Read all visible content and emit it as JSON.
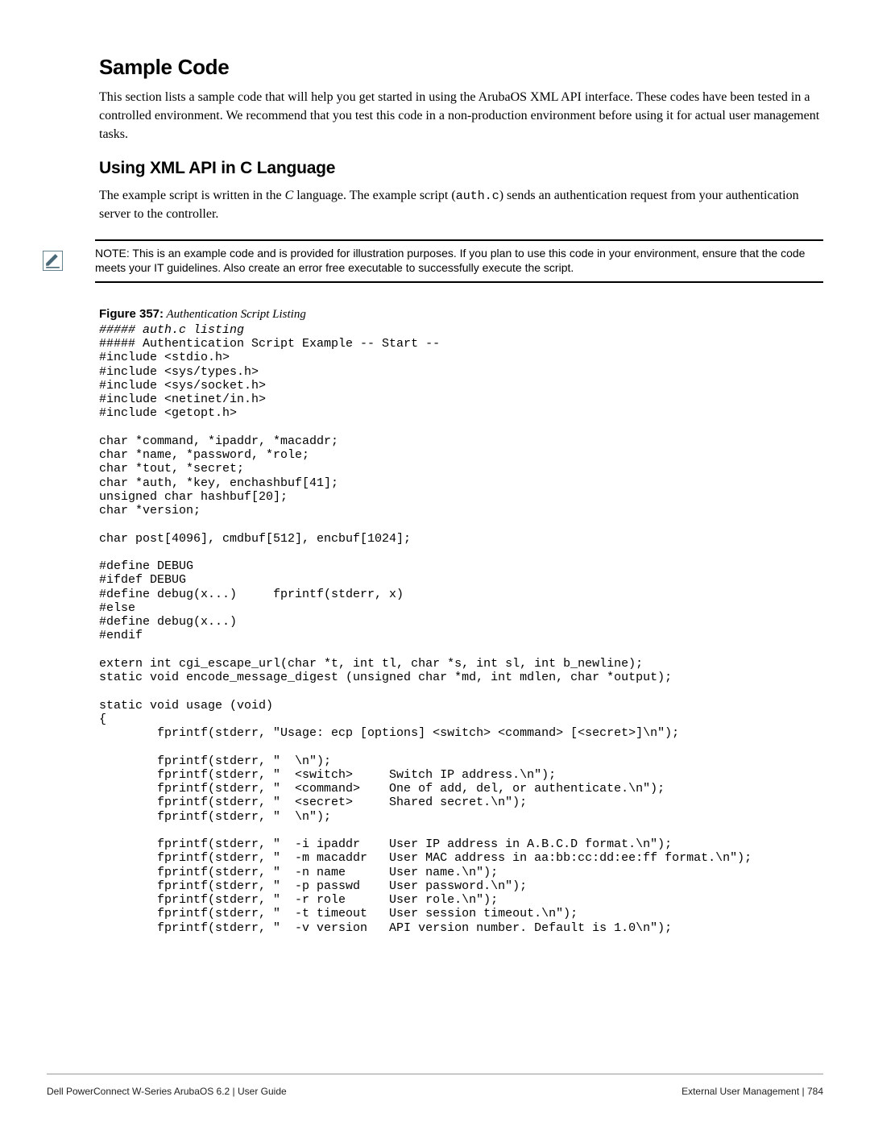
{
  "heading1": "Sample Code",
  "para1": "This section lists a sample code that will help you get started in using the ArubaOS XML API interface. These codes have been tested in a controlled environment. We recommend that you test this code in a non-production environment before using it for actual user management tasks.",
  "heading2": "Using XML API in C Language",
  "para2_pre": "The example script is written in the ",
  "para2_italic": "C",
  "para2_mid": " language. The example script (",
  "para2_mono": "auth.c",
  "para2_post": ") sends an authentication request from your authentication server to the controller.",
  "note_text": "NOTE: This is an example code and is provided for illustration purposes. If you plan to use this code in your environment, ensure that the code meets your IT guidelines. Also create an error free executable to successfully execute the script.",
  "figure_label": "Figure 357:",
  "figure_title": " Authentication Script Listing",
  "code_line_italic": "##### auth.c listing",
  "code_body": "##### Authentication Script Example -- Start --\n#include <stdio.h>\n#include <sys/types.h>\n#include <sys/socket.h>\n#include <netinet/in.h>\n#include <getopt.h>\n\nchar *command, *ipaddr, *macaddr;\nchar *name, *password, *role;\nchar *tout, *secret;\nchar *auth, *key, enchashbuf[41];\nunsigned char hashbuf[20];\nchar *version;\n\nchar post[4096], cmdbuf[512], encbuf[1024];\n\n#define DEBUG\n#ifdef DEBUG\n#define debug(x...)     fprintf(stderr, x)\n#else\n#define debug(x...)\n#endif\n\nextern int cgi_escape_url(char *t, int tl, char *s, int sl, int b_newline);\nstatic void encode_message_digest (unsigned char *md, int mdlen, char *output);\n\nstatic void usage (void)\n{\n        fprintf(stderr, \"Usage: ecp [options] <switch> <command> [<secret>]\\n\");\n\n        fprintf(stderr, \"  \\n\");\n        fprintf(stderr, \"  <switch>     Switch IP address.\\n\");\n        fprintf(stderr, \"  <command>    One of add, del, or authenticate.\\n\");\n        fprintf(stderr, \"  <secret>     Shared secret.\\n\");\n        fprintf(stderr, \"  \\n\");\n\n        fprintf(stderr, \"  -i ipaddr    User IP address in A.B.C.D format.\\n\");\n        fprintf(stderr, \"  -m macaddr   User MAC address in aa:bb:cc:dd:ee:ff format.\\n\");\n        fprintf(stderr, \"  -n name      User name.\\n\");\n        fprintf(stderr, \"  -p passwd    User password.\\n\");\n        fprintf(stderr, \"  -r role      User role.\\n\");\n        fprintf(stderr, \"  -t timeout   User session timeout.\\n\");\n        fprintf(stderr, \"  -v version   API version number. Default is 1.0\\n\");",
  "footer_left": "Dell PowerConnect W-Series ArubaOS 6.2 | User Guide",
  "footer_right_text": "External User Management",
  "footer_right_divider": " | ",
  "footer_right_page": "784"
}
